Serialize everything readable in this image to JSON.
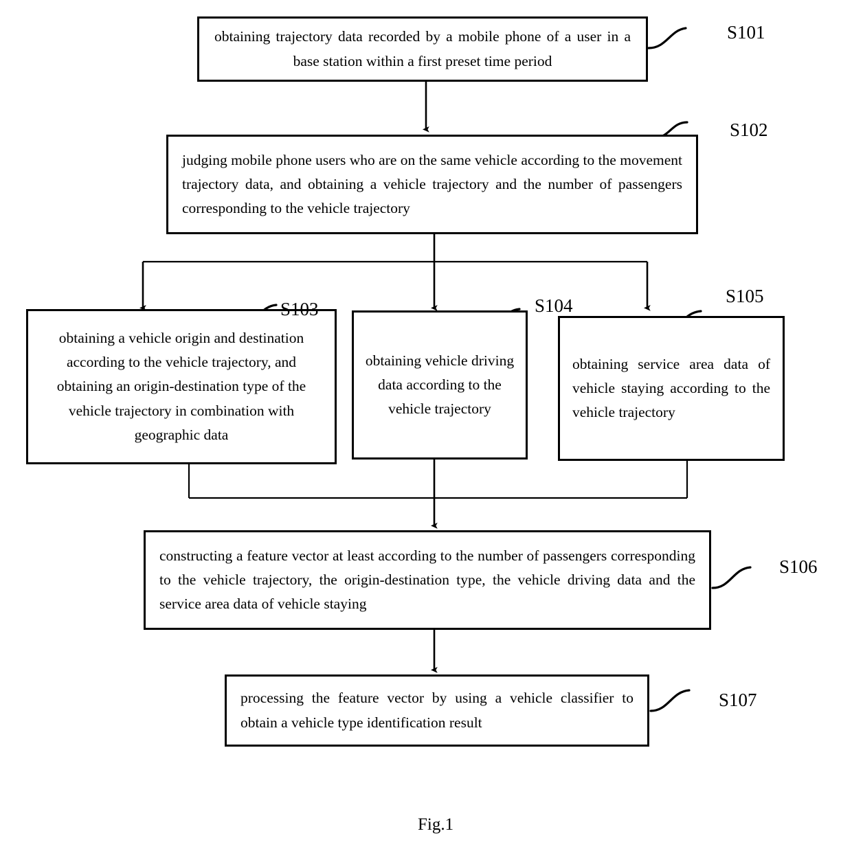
{
  "figure": {
    "caption": "Fig.1",
    "type": "flowchart",
    "orientation": "top-to-bottom"
  },
  "steps": [
    {
      "id": "S101",
      "label": "S101",
      "text": "obtaining trajectory data recorded by a mobile phone of a user in a base station within a first preset time period",
      "align": "just-center"
    },
    {
      "id": "S102",
      "label": "S102",
      "text": "judging mobile phone users who are on the same vehicle according to the movement trajectory data, and obtaining a vehicle trajectory and the number of passengers corresponding to the vehicle trajectory",
      "align": "justify"
    },
    {
      "id": "S103",
      "label": "S103",
      "text": "obtaining a vehicle origin and destination according to the vehicle trajectory, and obtaining an origin-destination type of the vehicle trajectory in combination with geographic data",
      "align": "center"
    },
    {
      "id": "S104",
      "label": "S104",
      "text": "obtaining vehicle driving data according to the vehicle trajectory",
      "align": "center"
    },
    {
      "id": "S105",
      "label": "S105",
      "text": "obtaining service area data of vehicle staying according to the vehicle trajectory",
      "align": "justify"
    },
    {
      "id": "S106",
      "label": "S106",
      "text": "constructing a feature vector at least according to the number of passengers corresponding to the vehicle trajectory, the origin-destination type, the vehicle driving data and the service area data of vehicle staying",
      "align": "justify"
    },
    {
      "id": "S107",
      "label": "S107",
      "text": "processing the feature vector by using a vehicle classifier to obtain a vehicle type identification result",
      "align": "justify"
    }
  ],
  "colors": {
    "stroke": "#000000",
    "background": "#ffffff",
    "text": "#000000"
  }
}
